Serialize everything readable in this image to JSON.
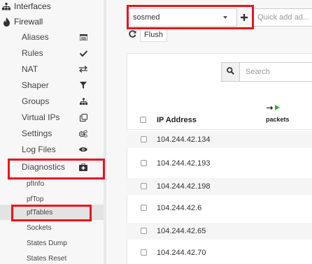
{
  "sidebar": {
    "interfaces": "Interfaces",
    "firewall": "Firewall",
    "items": [
      {
        "label": "Aliases",
        "icon": "list-icon"
      },
      {
        "label": "Rules",
        "icon": "check-icon"
      },
      {
        "label": "NAT",
        "icon": "exchange-icon"
      },
      {
        "label": "Shaper",
        "icon": "filter-icon"
      },
      {
        "label": "Groups",
        "icon": "sitemap-icon"
      },
      {
        "label": "Virtual IPs",
        "icon": "clone-icon"
      },
      {
        "label": "Settings",
        "icon": "cogs-icon"
      },
      {
        "label": "Log Files",
        "icon": "eye-icon"
      },
      {
        "label": "Diagnostics",
        "icon": "medkit-icon"
      }
    ],
    "sub_items": [
      {
        "label": "pfInfo"
      },
      {
        "label": "pfTop"
      },
      {
        "label": "pfTables"
      },
      {
        "label": "Sockets"
      },
      {
        "label": "States Dump"
      },
      {
        "label": "States Reset"
      }
    ]
  },
  "toolbar": {
    "table_select_value": "sosmed",
    "quick_add_placeholder": "Quick add ad...",
    "flush_label": "Flush"
  },
  "search": {
    "placeholder": "Search"
  },
  "table": {
    "col_ip": "IP Address",
    "col_packets": "packets",
    "rows": [
      {
        "ip": "104.244.42.134"
      },
      {
        "ip": "104.244.42.193"
      },
      {
        "ip": "104.244.42.198"
      },
      {
        "ip": "104.244.42.6"
      },
      {
        "ip": "104.244.42.65"
      },
      {
        "ip": "104.244.42.70"
      }
    ]
  },
  "colors": {
    "highlight": "#e8141f",
    "arrow_green": "#49a942"
  }
}
